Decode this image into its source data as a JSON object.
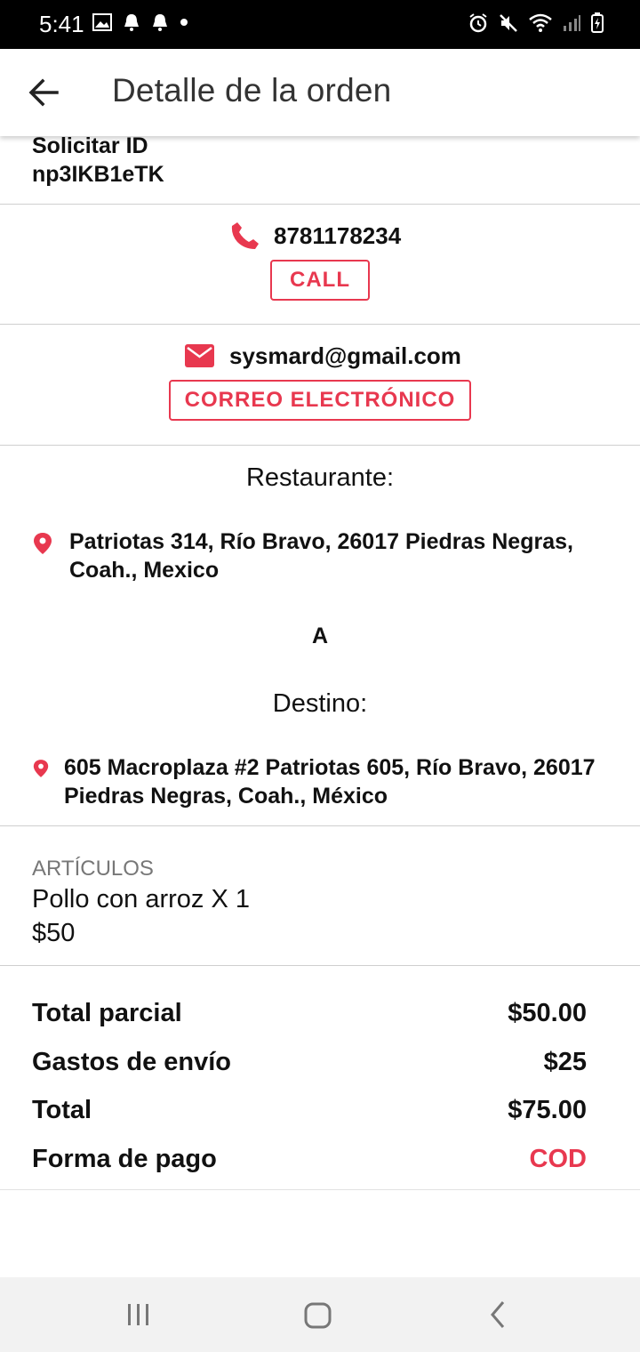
{
  "status_bar": {
    "time": "5:41"
  },
  "app_bar": {
    "title": "Detalle de la orden"
  },
  "order": {
    "id_label": "Solicitar ID",
    "id_value": "np3IKB1eTK"
  },
  "contact": {
    "phone": "8781178234",
    "call_label": "CALL",
    "email": "sysmard@gmail.com",
    "email_button_label": "CORREO ELECTRÓNICO"
  },
  "route": {
    "restaurant_label": "Restaurante:",
    "restaurant_address": "Patriotas 314, Río Bravo, 26017 Piedras Negras, Coah., Mexico",
    "to_label": "A",
    "destination_label": "Destino:",
    "destination_address": "605 Macroplaza #2 Patriotas 605, Río Bravo, 26017 Piedras Negras, Coah., México"
  },
  "items": {
    "header": "ARTÍCULOS",
    "list": [
      {
        "name": "Pollo con arroz X 1",
        "price": "$50"
      }
    ]
  },
  "summary": {
    "subtotal_label": "Total parcial",
    "subtotal_value": "$50.00",
    "shipping_label": "Gastos de envío",
    "shipping_value": "$25",
    "total_label": "Total",
    "total_value": "$75.00",
    "payment_label": "Forma de pago",
    "payment_value": "COD"
  },
  "colors": {
    "accent": "#e8384f",
    "text": "#111111",
    "muted": "#777777"
  },
  "icons": [
    "back-arrow-icon",
    "phone-icon",
    "mail-icon",
    "location-pin-icon",
    "recent-apps-icon",
    "home-icon",
    "nav-back-icon"
  ]
}
